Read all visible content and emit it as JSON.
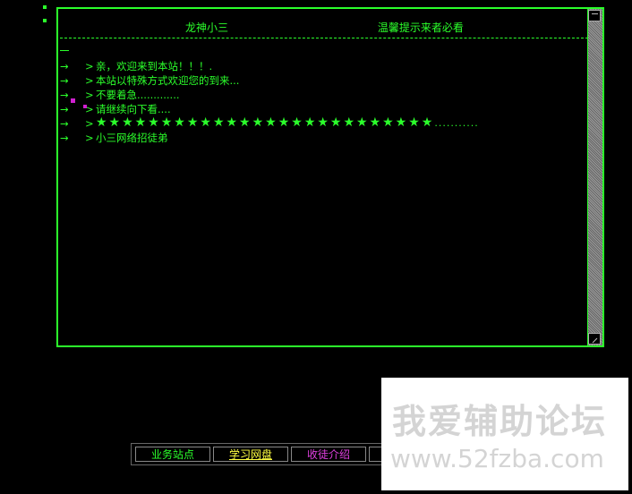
{
  "header": {
    "title": "龙神小三      温馨提示来者必看"
  },
  "window": {
    "lines": [
      {
        "arrow": "→",
        "gt": ">",
        "text": "亲，欢迎来到本站！！！."
      },
      {
        "arrow": "→",
        "gt": ">",
        "text": "本站以特殊方式欢迎您的到来..."
      },
      {
        "arrow": "→",
        "gt": ">",
        "text": "不要着急............."
      },
      {
        "arrow": "→",
        "gt": ">",
        "text": "请继续向下看...."
      },
      {
        "arrow": "→",
        "gt": ">",
        "stars": "★★★★★★★★★★★★★★★★★★★★★★★★★★",
        "stars_tail": "..........."
      },
      {
        "arrow": "→",
        "gt": ">",
        "text": "小三网络招徒弟"
      }
    ]
  },
  "tabs": [
    {
      "label": "业务站点",
      "color": "#2bff2b"
    },
    {
      "label": "学习网盘",
      "color": "#ffff40"
    },
    {
      "label": "收徒介绍",
      "color": "#e040e0"
    }
  ],
  "watermark": {
    "line1": "我爱辅助论坛",
    "line2": "www.52fzba.com"
  },
  "colors": {
    "text": "#2bff2b",
    "background": "#000000",
    "marker": "#d020d0"
  }
}
